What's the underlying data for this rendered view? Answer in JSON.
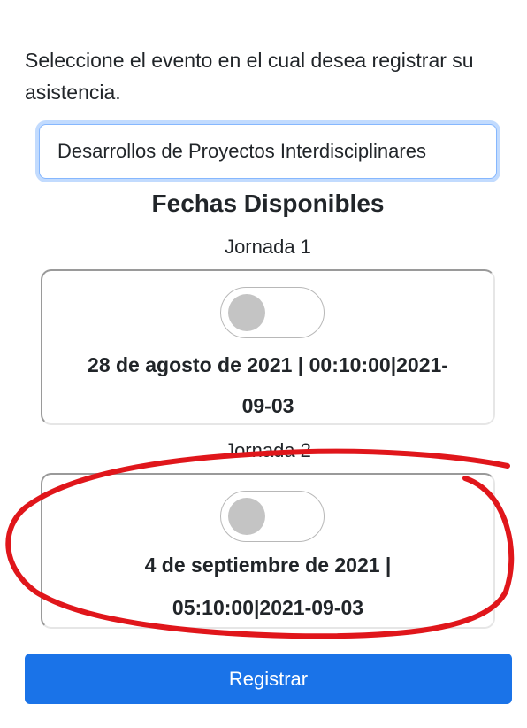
{
  "intro_text": "Seleccione el evento en el cual desea registrar su asistencia.",
  "event_select": {
    "selected": "Desarrollos de Proyectos Interdisciplinares"
  },
  "section_title": "Fechas Disponibles",
  "jornadas": [
    {
      "label": "Jornada 1",
      "toggle_on": false,
      "line1": "28 de agosto de 2021 | 00:10:00|2021-",
      "line2": "09-03"
    },
    {
      "label": "Jornada 2",
      "toggle_on": false,
      "line1": "4 de septiembre de 2021 |",
      "line2": "05:10:00|2021-09-03"
    }
  ],
  "register_button": "Registrar",
  "colors": {
    "primary": "#1a73e8",
    "annotation": "#e0161b",
    "toggle_knob": "#c4c4c4"
  }
}
